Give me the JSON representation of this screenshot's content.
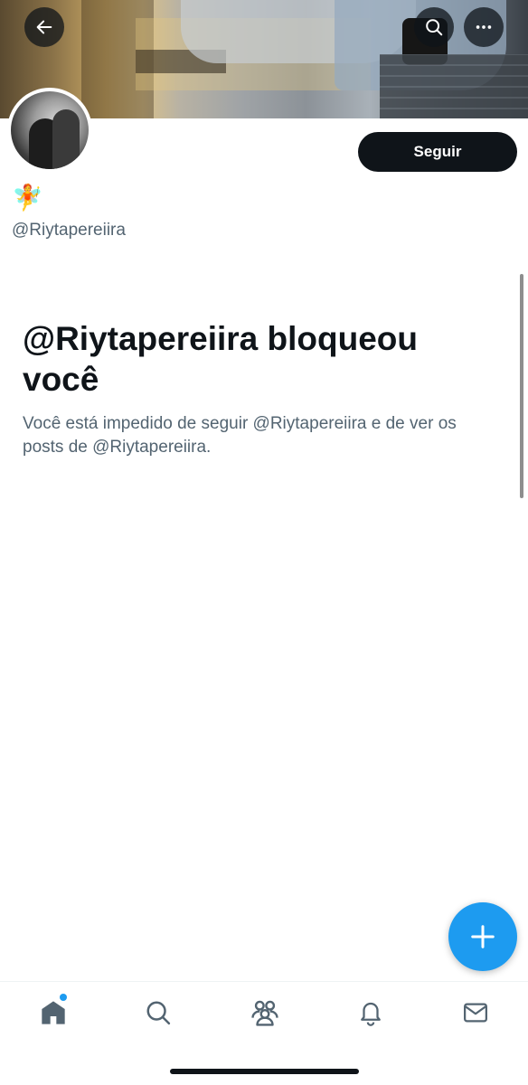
{
  "header": {
    "back_icon": "arrow-left-icon",
    "search_icon": "search-icon",
    "more_icon": "more-horizontal-icon"
  },
  "profile": {
    "emoji": "🧚",
    "handle": "@Riytapereiira",
    "follow_label": "Seguir"
  },
  "blocked": {
    "title": "@Riytapereiira bloqueou você",
    "description": "Você está impedido de seguir @Riytapereiira e de ver os posts de @Riytapereiira."
  },
  "fab": {
    "icon": "plus-icon",
    "color": "#1d9bf0"
  },
  "tabbar": {
    "items": [
      {
        "icon": "home-icon",
        "active": true,
        "has_dot": true
      },
      {
        "icon": "search-icon",
        "active": false
      },
      {
        "icon": "communities-icon",
        "active": false
      },
      {
        "icon": "bell-icon",
        "active": false
      },
      {
        "icon": "mail-icon",
        "active": false
      }
    ]
  },
  "colors": {
    "text_primary": "#0f1419",
    "text_secondary": "#536471",
    "accent": "#1d9bf0",
    "button_bg": "#0f1419"
  }
}
